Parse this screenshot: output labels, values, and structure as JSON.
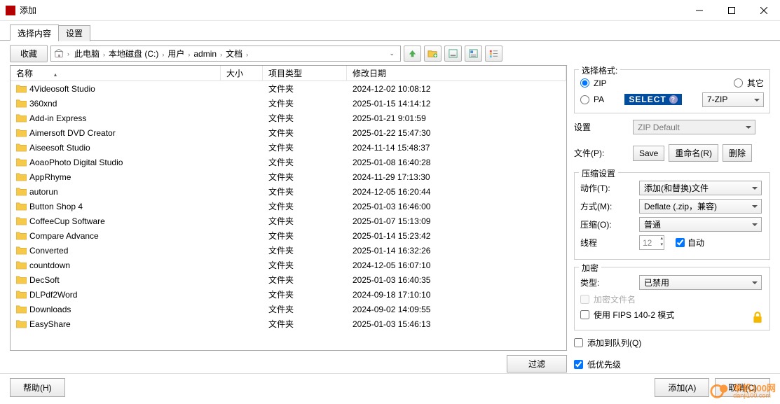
{
  "window": {
    "title": "添加"
  },
  "tabs": {
    "content": "选择内容",
    "settings": "设置"
  },
  "toolbar": {
    "favorites": "收藏"
  },
  "breadcrumb": [
    "此电脑",
    "本地磁盘 (C:)",
    "用户",
    "admin",
    "文档"
  ],
  "columns": {
    "name": "名称",
    "size": "大小",
    "type": "项目类型",
    "date": "修改日期"
  },
  "files": [
    {
      "name": "4Videosoft Studio",
      "type": "文件夹",
      "date": "2024-12-02 10:08:12"
    },
    {
      "name": "360xnd",
      "type": "文件夹",
      "date": "2025-01-15 14:14:12"
    },
    {
      "name": "Add-in Express",
      "type": "文件夹",
      "date": "2025-01-21 9:01:59"
    },
    {
      "name": "Aimersoft DVD Creator",
      "type": "文件夹",
      "date": "2025-01-22 15:47:30"
    },
    {
      "name": "Aiseesoft Studio",
      "type": "文件夹",
      "date": "2024-11-14 15:48:37"
    },
    {
      "name": "AoaoPhoto Digital Studio",
      "type": "文件夹",
      "date": "2025-01-08 16:40:28"
    },
    {
      "name": "AppRhyme",
      "type": "文件夹",
      "date": "2024-11-29 17:13:30"
    },
    {
      "name": "autorun",
      "type": "文件夹",
      "date": "2024-12-05 16:20:44"
    },
    {
      "name": "Button Shop 4",
      "type": "文件夹",
      "date": "2025-01-03 16:46:00"
    },
    {
      "name": "CoffeeCup Software",
      "type": "文件夹",
      "date": "2025-01-07 15:13:09"
    },
    {
      "name": "Compare Advance",
      "type": "文件夹",
      "date": "2025-01-14 15:23:42"
    },
    {
      "name": "Converted",
      "type": "文件夹",
      "date": "2025-01-14 16:32:26"
    },
    {
      "name": "countdown",
      "type": "文件夹",
      "date": "2024-12-05 16:07:10"
    },
    {
      "name": "DecSoft",
      "type": "文件夹",
      "date": "2025-01-03 16:40:35"
    },
    {
      "name": "DLPdf2Word",
      "type": "文件夹",
      "date": "2024-09-18 17:10:10"
    },
    {
      "name": "Downloads",
      "type": "文件夹",
      "date": "2024-09-02 14:09:55"
    },
    {
      "name": "EasyShare",
      "type": "文件夹",
      "date": "2025-01-03 15:46:13"
    }
  ],
  "filter_btn": "过滤",
  "side": {
    "format_title": "选择格式:",
    "zip": "ZIP",
    "other": "其它",
    "pa": "PA",
    "select_badge": "SELECT",
    "other_select": "7-ZIP",
    "settings_label": "设置",
    "file_label": "文件(P):",
    "settings_select": "ZIP Default",
    "save": "Save",
    "rename": "重命名(R)",
    "delete": "删除",
    "comp_title": "压缩设置",
    "action_label": "动作(T):",
    "action_val": "添加(和替换)文件",
    "method_label": "方式(M):",
    "method_val": "Deflate (.zip，兼容)",
    "level_label": "压缩(O):",
    "level_val": "普通",
    "threads_label": "线程",
    "threads_val": "12",
    "auto": "自动",
    "enc_title": "加密",
    "type_label": "类型:",
    "type_val": "已禁用",
    "enc_filename": "加密文件名",
    "fips": "使用 FIPS 140-2 模式",
    "queue": "添加到队列(Q)",
    "lowpri": "低优先级"
  },
  "bottom": {
    "help": "帮助(H)",
    "add": "添加(A)",
    "cancel": "取消(C)"
  },
  "watermark": {
    "cn": "单机100网",
    "en": "danji100.com"
  }
}
